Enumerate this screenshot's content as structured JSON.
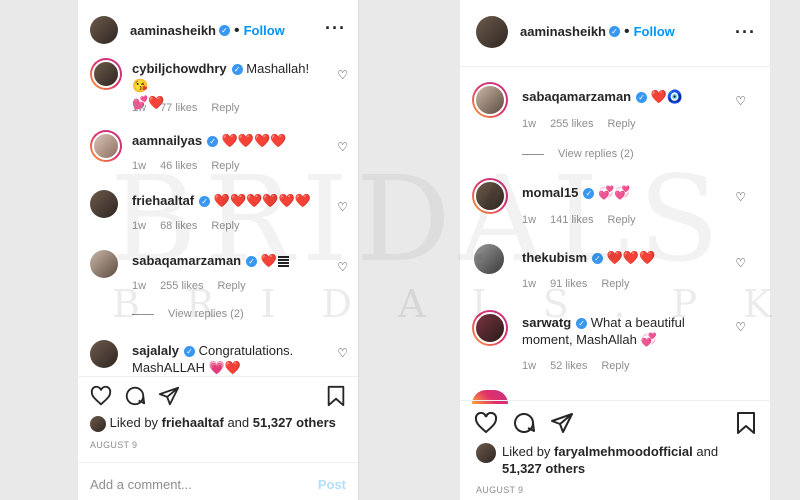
{
  "left": {
    "header": {
      "username": "aaminasheikh",
      "separator": "•",
      "follow": "Follow"
    },
    "comments": [
      {
        "user": "cybiljchowdhry",
        "text": "Mashallah! 😘",
        "text2": "💕❤️",
        "age": "1w",
        "likes": "77 likes",
        "reply": "Reply"
      },
      {
        "user": "aamnailyas",
        "text": "❤️❤️❤️❤️",
        "age": "1w",
        "likes": "46 likes",
        "reply": "Reply"
      },
      {
        "user": "friehaaltaf",
        "text": "❤️❤️❤️❤️❤️❤️",
        "age": "1w",
        "likes": "68 likes",
        "reply": "Reply"
      },
      {
        "user": "sabaqamarzaman",
        "text": "❤️",
        "age": "1w",
        "likes": "255 likes",
        "reply": "Reply"
      },
      {
        "user": "sajalaly",
        "text": "Congratulations.",
        "text2": "MashALLAH 💗❤️"
      }
    ],
    "view_replies": "View replies (2)",
    "liked_by_prefix": "Liked by",
    "liked_by_user": "friehaaltaf",
    "liked_by_and": "and",
    "liked_by_count": "51,327 others",
    "date": "AUGUST 9",
    "add_comment_placeholder": "Add a comment...",
    "post_label": "Post"
  },
  "right": {
    "header": {
      "username": "aaminasheikh",
      "separator": "•",
      "follow": "Follow"
    },
    "comments": [
      {
        "user": "sabaqamarzaman",
        "text": "❤️🧿",
        "age": "1w",
        "likes": "255 likes",
        "reply": "Reply"
      },
      {
        "user": "momal15",
        "text": "💞💞",
        "age": "1w",
        "likes": "141 likes",
        "reply": "Reply"
      },
      {
        "user": "thekubism",
        "text": "❤️❤️❤️",
        "age": "1w",
        "likes": "91 likes",
        "reply": "Reply"
      },
      {
        "user": "sarwatg",
        "text": "What a beautiful",
        "text2": "moment, MashAllah 💞",
        "age": "1w",
        "likes": "52 likes",
        "reply": "Reply"
      }
    ],
    "view_replies": "View replies (2)",
    "liked_by_prefix": "Liked by",
    "liked_by_user": "faryalmehmoodofficial",
    "liked_by_and": "and",
    "liked_by_count": "51,327 others",
    "date": "AUGUST 9"
  },
  "watermark": {
    "big": "BRIDALS",
    "small": "BRIDALS.PK"
  },
  "colors": {
    "verified": "#3897f0",
    "follow": "#0095f6",
    "muted": "#8e8e8e",
    "heart_red": "#ed1c24"
  }
}
